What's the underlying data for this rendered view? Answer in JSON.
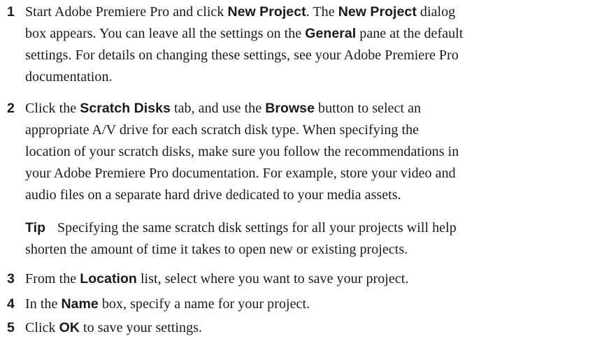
{
  "steps": [
    {
      "number": "1",
      "lines": [
        [
          {
            "t": "Start Adobe Premiere Pro and click "
          },
          {
            "t": "New Project",
            "ui": true
          },
          {
            "t": ". The "
          },
          {
            "t": "New Project",
            "ui": true
          },
          {
            "t": " dialog"
          }
        ],
        [
          {
            "t": "box appears. You can leave all the settings on the "
          },
          {
            "t": "General",
            "ui": true
          },
          {
            "t": " pane at the default"
          }
        ],
        [
          {
            "t": "settings. For details on changing these settings, see your Adobe Premiere Pro"
          }
        ],
        [
          {
            "t": "documentation."
          }
        ]
      ]
    },
    {
      "number": "2",
      "lines": [
        [
          {
            "t": "Click the "
          },
          {
            "t": "Scratch Disks",
            "ui": true
          },
          {
            "t": " tab, and use the "
          },
          {
            "t": "Browse",
            "ui": true
          },
          {
            "t": " button to select an"
          }
        ],
        [
          {
            "t": "appropriate A/V drive for each scratch disk type. When specifying the"
          }
        ],
        [
          {
            "t": "location of your scratch disks, make sure you follow the recommendations in"
          }
        ],
        [
          {
            "t": "your Adobe Premiere Pro documentation. For example, store your video and"
          }
        ],
        [
          {
            "t": "audio files on a separate hard drive dedicated to your media assets."
          }
        ]
      ]
    },
    {
      "number": "3",
      "lines": [
        [
          {
            "t": "From the "
          },
          {
            "t": "Location",
            "ui": true
          },
          {
            "t": " list, select where you want to save your project."
          }
        ]
      ]
    },
    {
      "number": "4",
      "lines": [
        [
          {
            "t": "In the "
          },
          {
            "t": "Name",
            "ui": true
          },
          {
            "t": " box, specify a name for your project."
          }
        ]
      ]
    },
    {
      "number": "5",
      "lines": [
        [
          {
            "t": "Click "
          },
          {
            "t": "OK",
            "ui": true
          },
          {
            "t": " to save your settings."
          }
        ]
      ]
    }
  ],
  "tip": {
    "label": "Tip",
    "line1": "Specifying the same scratch disk settings for all your projects will help",
    "line2": "shorten the amount of time it takes to open new or existing projects."
  }
}
